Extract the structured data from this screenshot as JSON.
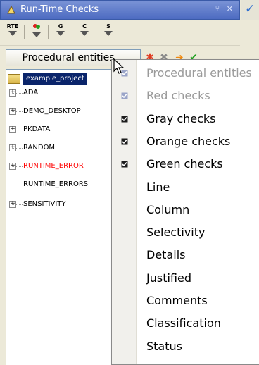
{
  "window": {
    "title": "Run-Time Checks",
    "buttons": "⑂ ✕"
  },
  "toolbar": {
    "buttons": [
      {
        "icon": "rte-filter-icon",
        "label": "RTE"
      },
      {
        "icon": "red-check-filter-icon",
        "label": ""
      },
      {
        "icon": "gray-check-filter-icon",
        "label": "G"
      },
      {
        "icon": "c-filter-icon",
        "label": "C"
      },
      {
        "icon": "s-filter-icon",
        "label": "S"
      }
    ]
  },
  "column_header": {
    "label": "Procedural entities"
  },
  "tree": {
    "root": "example_project",
    "items": [
      {
        "label": "ADA",
        "color": "#000000",
        "expandable": true
      },
      {
        "label": "DEMO_DESKTOP",
        "color": "#000000",
        "expandable": true
      },
      {
        "label": "PKDATA",
        "color": "#000000",
        "expandable": true
      },
      {
        "label": "RANDOM",
        "color": "#000000",
        "expandable": true
      },
      {
        "label": "RUNTIME_ERROR",
        "color": "#ff0000",
        "expandable": true
      },
      {
        "label": "RUNTIME_ERRORS",
        "color": "#000000",
        "expandable": false
      },
      {
        "label": "SENSITIVITY",
        "color": "#000000",
        "expandable": true
      }
    ]
  },
  "menu": {
    "items": [
      {
        "label": "Procedural entities",
        "checked": true,
        "disabled": true
      },
      {
        "label": "Red checks",
        "checked": true,
        "disabled": true
      },
      {
        "label": "Gray checks",
        "checked": true,
        "disabled": false
      },
      {
        "label": "Orange checks",
        "checked": true,
        "disabled": false
      },
      {
        "label": "Green checks",
        "checked": true,
        "disabled": false
      },
      {
        "label": "Line",
        "checked": false,
        "disabled": false
      },
      {
        "label": "Column",
        "checked": false,
        "disabled": false
      },
      {
        "label": "Selectivity",
        "checked": false,
        "disabled": false
      },
      {
        "label": "Details",
        "checked": false,
        "disabled": false
      },
      {
        "label": "Justified",
        "checked": false,
        "disabled": false
      },
      {
        "label": "Comments",
        "checked": false,
        "disabled": false
      },
      {
        "label": "Classification",
        "checked": false,
        "disabled": false
      },
      {
        "label": "Status",
        "checked": false,
        "disabled": false
      }
    ]
  }
}
